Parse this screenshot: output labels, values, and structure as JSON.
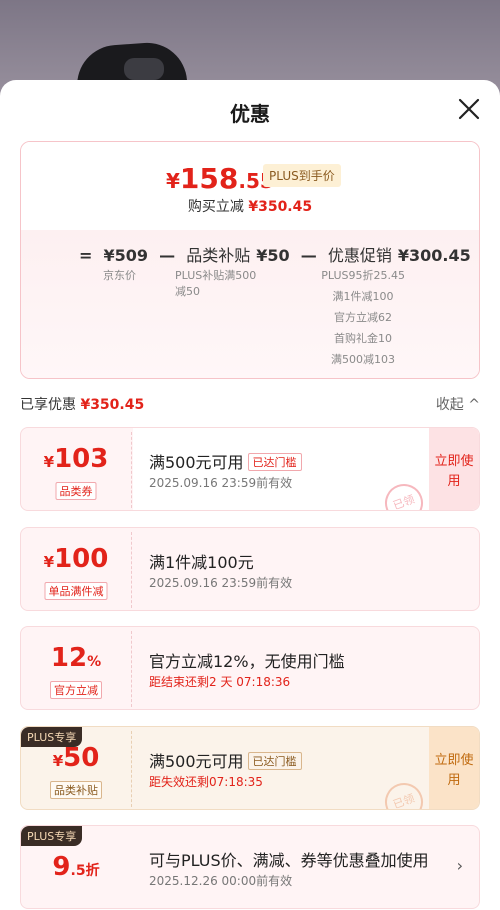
{
  "sheet": {
    "title": "优惠"
  },
  "price_card": {
    "currency": "¥",
    "price_int": "158",
    "price_dec": ".55",
    "price_tag": "PLUS到手价",
    "bought_label": "购买立减",
    "bought_amount": "¥350.45",
    "formula": {
      "eq": "=",
      "jd_price": "¥509",
      "minus1": "—",
      "cat_label": "品类补贴",
      "cat_amount": "¥50",
      "minus2": "—",
      "promo_label": "优惠促销",
      "promo_amount": "¥300.45",
      "jd_price_label": "京东价",
      "cat_detail": "PLUS补贴满500减50",
      "promo_details": [
        "PLUS95折25.45",
        "满1件减100",
        "官方立减62",
        "首购礼金10",
        "满500减103"
      ]
    }
  },
  "enjoyed": {
    "label": "已享优惠",
    "amount": "¥350.45",
    "collapse": "收起 ^"
  },
  "coupons": [
    {
      "currency": "¥",
      "amount": "103",
      "unit": "",
      "type": "品类券",
      "title": "满500元可用",
      "reached": "已达门槛",
      "sub": "2025.09.16 23:59前有效",
      "action": "立即使用",
      "stamp": "已领"
    },
    {
      "currency": "¥",
      "amount": "100",
      "unit": "",
      "type": "单品满件减",
      "title": "满1件减100元",
      "sub": "2025.09.16 23:59前有效"
    },
    {
      "currency": "",
      "amount": "12",
      "unit": "%",
      "type": "官方立减",
      "title": "官方立减12%，无使用门槛",
      "sub": "距结束还剩2 天 07:18:36"
    },
    {
      "badge": "PLUS专享",
      "currency": "¥",
      "amount": "50",
      "unit": "",
      "type": "品类补贴",
      "title": "满500元可用",
      "reached": "已达门槛",
      "sub": "距失效还剩07:18:35",
      "action": "立即使用",
      "stamp": "已领"
    },
    {
      "badge": "PLUS专享",
      "currency": "",
      "amount": "9",
      "unit": ".5折",
      "type": "",
      "title": "可与PLUS价、满减、券等优惠叠加使用",
      "sub": "2025.12.26 00:00前有效",
      "chevron": "›"
    }
  ],
  "colors": {
    "accent_red": "#e2231a",
    "plus_gold": "#8a5a1f",
    "backdrop": "#7d7686"
  },
  "icons": {
    "close": "close-icon",
    "chevron": "chevron-right-icon"
  }
}
